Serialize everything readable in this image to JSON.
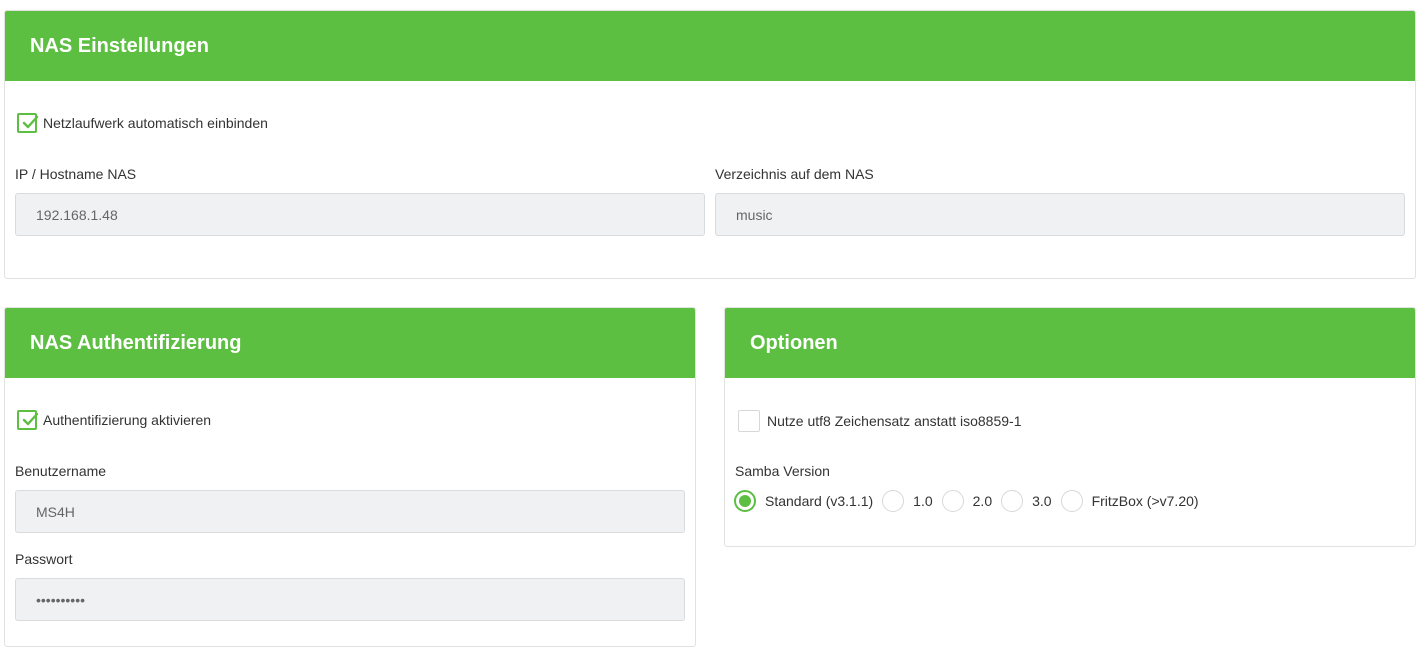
{
  "nas_settings": {
    "title": "NAS Einstellungen",
    "auto_mount_label": "Netzlaufwerk automatisch einbinden",
    "auto_mount_checked": true,
    "host_label": "IP / Hostname NAS",
    "host_value": "192.168.1.48",
    "dir_label": "Verzeichnis auf dem NAS",
    "dir_value": "music"
  },
  "nas_auth": {
    "title": "NAS Authentifizierung",
    "enable_label": "Authentifizierung aktivieren",
    "enable_checked": true,
    "user_label": "Benutzername",
    "user_value": "MS4H",
    "pass_label": "Passwort",
    "pass_value": "••••••••••"
  },
  "options": {
    "title": "Optionen",
    "utf8_label": "Nutze utf8 Zeichensatz anstatt iso8859-1",
    "utf8_checked": false,
    "samba_label": "Samba Version",
    "samba_options": [
      "Standard (v3.1.1)",
      "1.0",
      "2.0",
      "3.0",
      "FritzBox (>v7.20)"
    ],
    "samba_selected": "Standard (v3.1.1)"
  },
  "colors": {
    "accent": "#5cbf42",
    "input_bg": "#eff1f3"
  }
}
